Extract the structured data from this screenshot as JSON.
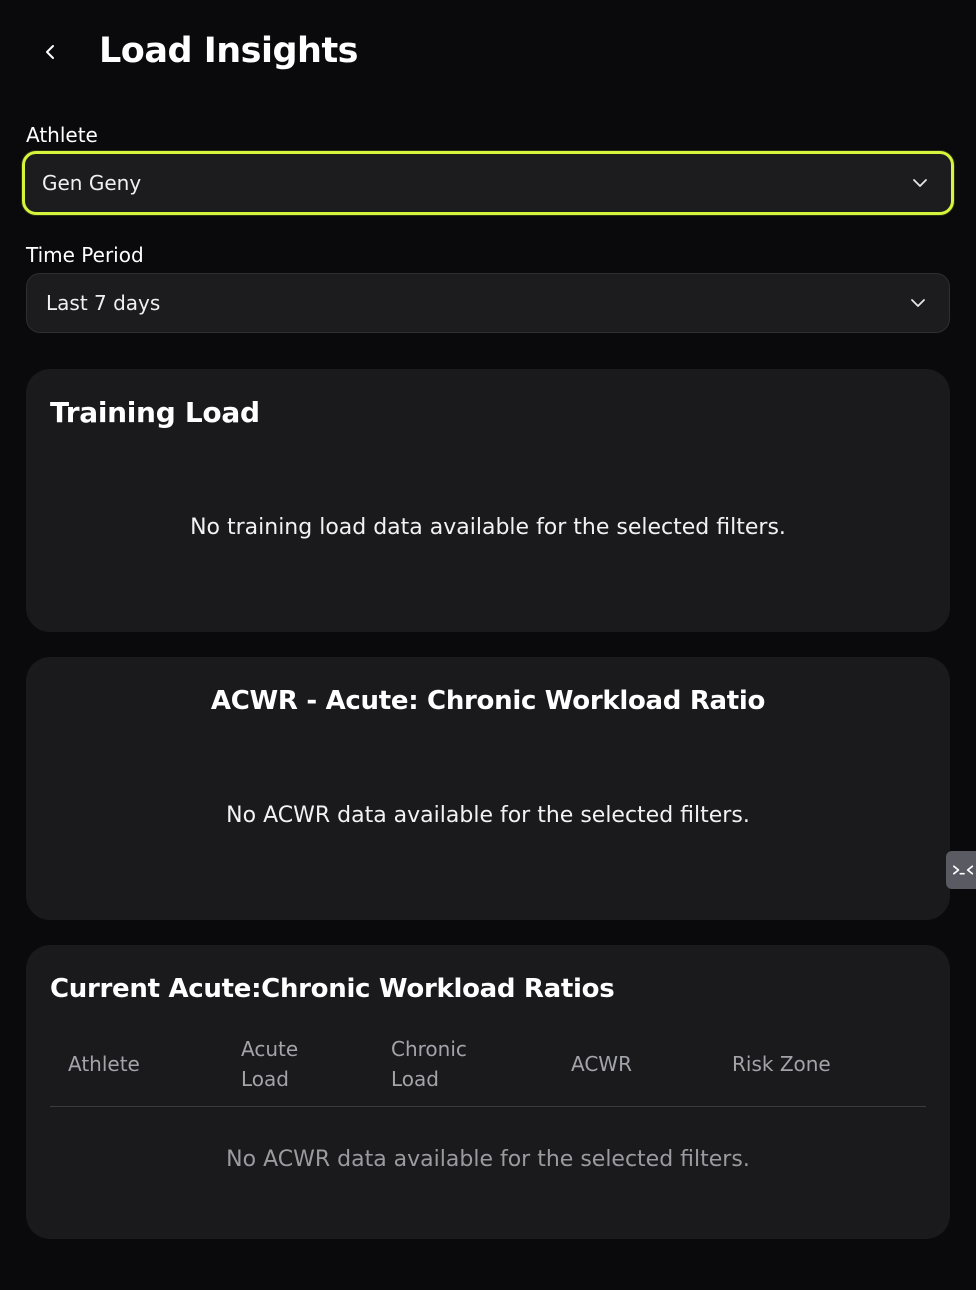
{
  "header": {
    "title": "Load Insights"
  },
  "filters": {
    "athlete": {
      "label": "Athlete",
      "value": "Gen Geny"
    },
    "time_period": {
      "label": "Time Period",
      "value": "Last 7 days"
    }
  },
  "training_load": {
    "title": "Training Load",
    "empty_message": "No training load data available for the selected filters."
  },
  "acwr_chart": {
    "title": "ACWR - Acute: Chronic Workload Ratio",
    "empty_message": "No ACWR data available for the selected filters."
  },
  "ratios_table": {
    "title": "Current Acute:Chronic Workload Ratios",
    "columns": {
      "athlete": "Athlete",
      "acute_line1": "Acute",
      "acute_line2": "Load",
      "chronic_line1": "Chronic",
      "chronic_line2": "Load",
      "acwr": "ACWR",
      "risk_zone": "Risk Zone"
    },
    "empty_message": "No ACWR data available for the selected filters."
  },
  "colors": {
    "background": "#0a0a0c",
    "card": "#1a1a1d",
    "accent_focus": "#d4f53c"
  },
  "icons": {
    "back": "chevron-left-icon",
    "dropdown": "chevron-down-icon",
    "side_tab": "terminal-icon"
  }
}
